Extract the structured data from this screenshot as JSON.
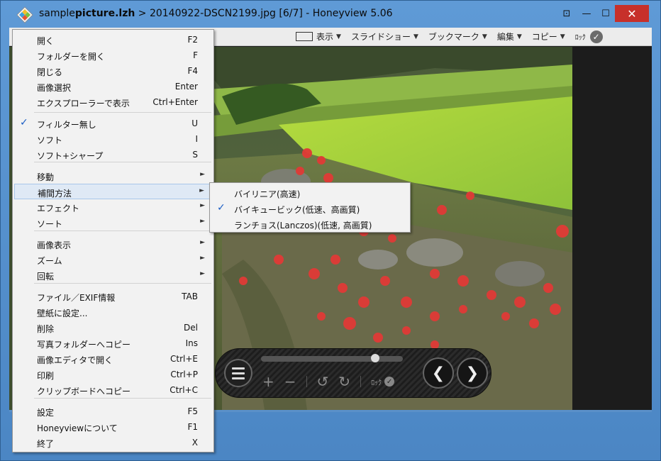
{
  "window": {
    "title_prefix": "sample",
    "title_bold": "picture.lzh",
    "title_rest": " > 20140922-DSCN2199.jpg [6/7] - Honeyview 5.06",
    "pin_glyph": "⊡",
    "min_glyph": "—",
    "max_glyph": "☐",
    "close_glyph": "✕"
  },
  "toolbar": {
    "view": "表示",
    "slideshow": "スライドショー",
    "bookmark": "ブックマーク",
    "edit": "編集",
    "copy": "コピー",
    "lock": "ﾛｯｸ",
    "lock_check": "✓",
    "arrow": "▼"
  },
  "menu": {
    "items": [
      {
        "label": "開く",
        "shortcut": "F2"
      },
      {
        "label": "フォルダーを開く",
        "shortcut": "F"
      },
      {
        "label": "閉じる",
        "shortcut": "F4"
      },
      {
        "label": "画像選択",
        "shortcut": "Enter"
      },
      {
        "label": "エクスプローラーで表示",
        "shortcut": "Ctrl+Enter"
      },
      {
        "label": "フィルター無し",
        "shortcut": "U",
        "checked": true
      },
      {
        "label": "ソフト",
        "shortcut": "I"
      },
      {
        "label": "ソフト+シャープ",
        "shortcut": "S"
      },
      {
        "label": "移動",
        "submenu": true
      },
      {
        "label": "補間方法",
        "submenu": true,
        "highlighted": true
      },
      {
        "label": "エフェクト",
        "submenu": true
      },
      {
        "label": "ソート",
        "submenu": true
      },
      {
        "label": "画像表示",
        "submenu": true
      },
      {
        "label": "ズーム",
        "submenu": true
      },
      {
        "label": "回転",
        "submenu": true
      },
      {
        "label": "ファイル／EXIF情報",
        "shortcut": "TAB"
      },
      {
        "label": "壁紙に設定...",
        "shortcut": ""
      },
      {
        "label": "削除",
        "shortcut": "Del"
      },
      {
        "label": "写真フォルダーへコピー",
        "shortcut": "Ins"
      },
      {
        "label": "画像エディタで開く",
        "shortcut": "Ctrl+E"
      },
      {
        "label": "印刷",
        "shortcut": "Ctrl+P"
      },
      {
        "label": "クリップボードへコピー",
        "shortcut": "Ctrl+C"
      },
      {
        "label": "設定",
        "shortcut": "F5"
      },
      {
        "label": "Honeyviewについて",
        "shortcut": "F1"
      },
      {
        "label": "終了",
        "shortcut": "X"
      }
    ],
    "check_glyph": "✓",
    "submenu_glyph": "►"
  },
  "submenu": {
    "items": [
      {
        "label": "バイリニア(高速)"
      },
      {
        "label": "バイキュービック(低速、高画質)",
        "checked": true
      },
      {
        "label": "ランチョス(Lanczos)(低速, 高画質)"
      }
    ]
  },
  "controls": {
    "zoom_in": "+",
    "zoom_out": "−",
    "rotate_left": "↺",
    "rotate_right": "↻",
    "lock": "ﾛｯｸ",
    "lock_check": "✓",
    "prev": "❮",
    "next": "❯"
  },
  "colors": {
    "accent_check": "#1a5dc4",
    "close_button": "#c7302a",
    "menu_highlight": "#dfe9f5"
  }
}
